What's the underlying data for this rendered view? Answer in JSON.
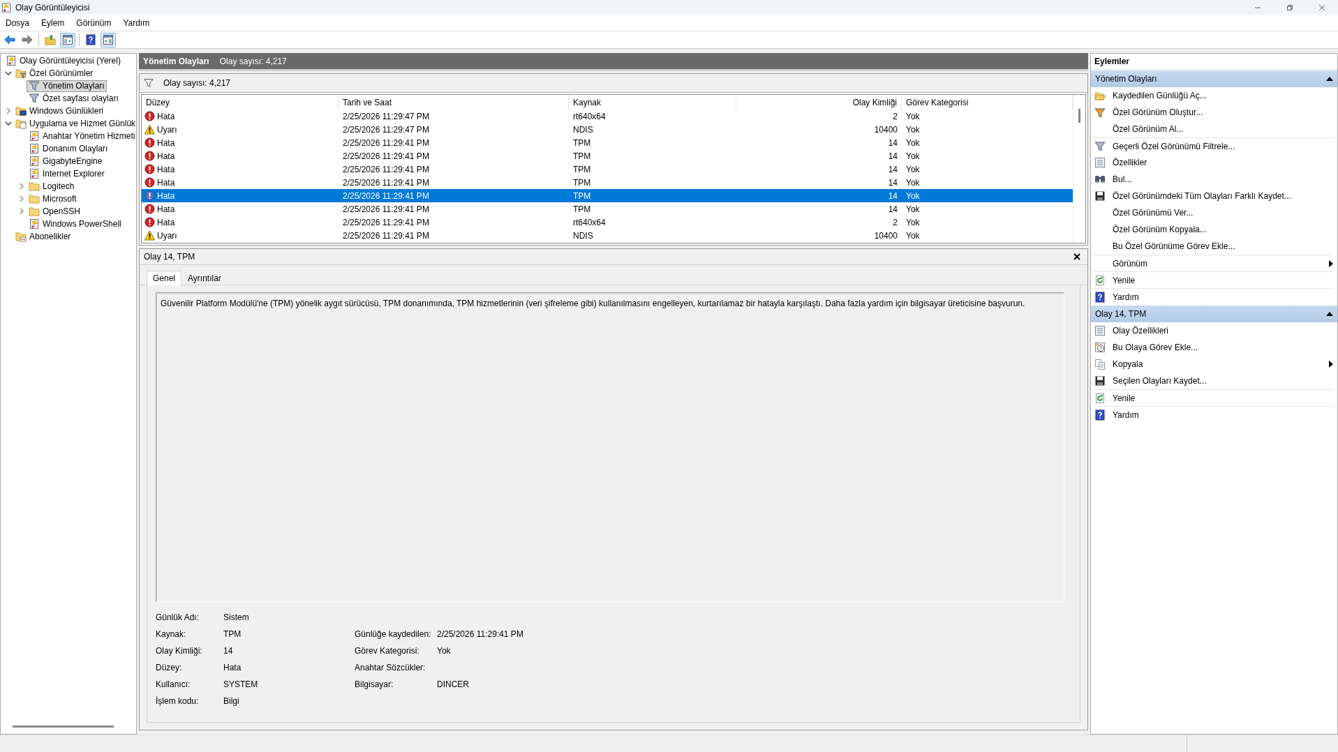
{
  "window": {
    "title": "Olay Görüntüleyicisi"
  },
  "menu": [
    "Dosya",
    "Eylem",
    "Görünüm",
    "Yardım"
  ],
  "toolbar": [
    {
      "kind": "back",
      "disabled": false,
      "pressed": false
    },
    {
      "kind": "forward",
      "disabled": true,
      "pressed": false
    },
    {
      "kind": "separator"
    },
    {
      "kind": "up",
      "disabled": false,
      "pressed": false
    },
    {
      "kind": "tree-pane",
      "disabled": false,
      "pressed": true
    },
    {
      "kind": "separator"
    },
    {
      "kind": "help",
      "disabled": false,
      "pressed": false
    },
    {
      "kind": "action-pane",
      "disabled": false,
      "pressed": true
    }
  ],
  "tree": [
    {
      "label": "Olay Görüntüleyicisi (Yerel)",
      "kind": "log",
      "selected": false,
      "children": [
        {
          "label": "Özel Görünümler",
          "kind": "folder-filter",
          "selected": false,
          "expanded": true,
          "children": [
            {
              "label": "Yönetim Olayları",
              "kind": "filter",
              "selected": true
            },
            {
              "label": "Özet sayfası olayları",
              "kind": "filter",
              "selected": false
            }
          ]
        },
        {
          "label": "Windows Günlükleri",
          "kind": "folder-monitor",
          "selected": false,
          "expanded": false
        },
        {
          "label": "Uygulama ve Hizmet Günlük",
          "kind": "folder-doc",
          "selected": false,
          "expanded": true,
          "children": [
            {
              "label": "Anahtar Yönetim Hizmeti",
              "kind": "log",
              "selected": false
            },
            {
              "label": "Donanım Olayları",
              "kind": "log",
              "selected": false
            },
            {
              "label": "GigabyteEngine",
              "kind": "log",
              "selected": false
            },
            {
              "label": "Internet Explorer",
              "kind": "log",
              "selected": false
            },
            {
              "label": "Logitech",
              "kind": "folder",
              "selected": false,
              "expanded": false
            },
            {
              "label": "Microsoft",
              "kind": "folder",
              "selected": false,
              "expanded": false
            },
            {
              "label": "OpenSSH",
              "kind": "folder",
              "selected": false,
              "expanded": false
            },
            {
              "label": "Windows PowerShell",
              "kind": "log",
              "selected": false
            }
          ]
        },
        {
          "label": "Abonelikler",
          "kind": "folder-sub",
          "selected": false
        }
      ]
    }
  ],
  "view_header": {
    "title": "Yönetim Olayları",
    "count": "Olay sayısı: 4,217"
  },
  "filter_bar": {
    "text": "Olay sayısı: 4,217"
  },
  "table": {
    "columns": [
      {
        "label": "Düzey",
        "kind": "text"
      },
      {
        "label": "Tarih ve Saat",
        "kind": "text"
      },
      {
        "label": "Kaynak",
        "kind": "text"
      },
      {
        "label": "Olay Kimliği",
        "kind": "number"
      },
      {
        "label": "Görev Kategorisi",
        "kind": "text"
      }
    ],
    "rows": [
      {
        "kind": "error",
        "selected": false,
        "cells": [
          "Hata",
          "2/25/2026 11:29:47 PM",
          "rt640x64",
          "2",
          "Yok"
        ]
      },
      {
        "kind": "warning",
        "selected": false,
        "cells": [
          "Uyarı",
          "2/25/2026 11:29:47 PM",
          "NDIS",
          "10400",
          "Yok"
        ]
      },
      {
        "kind": "error",
        "selected": false,
        "cells": [
          "Hata",
          "2/25/2026 11:29:41 PM",
          "TPM",
          "14",
          "Yok"
        ]
      },
      {
        "kind": "error",
        "selected": false,
        "cells": [
          "Hata",
          "2/25/2026 11:29:41 PM",
          "TPM",
          "14",
          "Yok"
        ]
      },
      {
        "kind": "error",
        "selected": false,
        "cells": [
          "Hata",
          "2/25/2026 11:29:41 PM",
          "TPM",
          "14",
          "Yok"
        ]
      },
      {
        "kind": "error",
        "selected": false,
        "cells": [
          "Hata",
          "2/25/2026 11:29:41 PM",
          "TPM",
          "14",
          "Yok"
        ]
      },
      {
        "kind": "error",
        "selected": true,
        "cells": [
          "Hata",
          "2/25/2026 11:29:41 PM",
          "TPM",
          "14",
          "Yok"
        ]
      },
      {
        "kind": "error",
        "selected": false,
        "cells": [
          "Hata",
          "2/25/2026 11:29:41 PM",
          "TPM",
          "14",
          "Yok"
        ]
      },
      {
        "kind": "error",
        "selected": false,
        "cells": [
          "Hata",
          "2/25/2026 11:29:41 PM",
          "rt640x64",
          "2",
          "Yok"
        ]
      },
      {
        "kind": "warning",
        "selected": false,
        "cells": [
          "Uyarı",
          "2/25/2026 11:29:41 PM",
          "NDIS",
          "10400",
          "Yok"
        ]
      }
    ]
  },
  "detail": {
    "title": "Olay 14, TPM",
    "tabs": [
      {
        "label": "Genel",
        "selected": true
      },
      {
        "label": "Ayrıntılar",
        "selected": false
      }
    ],
    "description": "Güvenilir Platform Modülü'ne (TPM) yönelik aygıt sürücüsü, TPM donanımında, TPM hizmetlerinin (veri şifreleme gibi) kullanılmasını engelleyen, kurtarılamaz bir hatayla karşılaştı. Daha fazla yardım için bilgisayar üreticisine başvurun.",
    "fields": [
      {
        "left": {
          "label": "Günlük Adı:",
          "value": "Sistem"
        }
      },
      {
        "left": {
          "label": "Kaynak:",
          "value": "TPM"
        },
        "right": {
          "label": "Günlüğe kaydedilen:",
          "value": "2/25/2026 11:29:41 PM"
        }
      },
      {
        "left": {
          "label": "Olay Kimliği:",
          "value": "14"
        },
        "right": {
          "label": "Görev Kategorisi:",
          "value": "Yok"
        }
      },
      {
        "left": {
          "label": "Düzey:",
          "value": "Hata"
        },
        "right": {
          "label": "Anahtar Sözcükler:"
        }
      },
      {
        "left": {
          "label": "Kullanıcı:",
          "value": "SYSTEM"
        },
        "right": {
          "label": "Bilgisayar:",
          "value": "DINCER"
        }
      },
      {
        "left": {
          "label": "İşlem kodu:",
          "value": "Bilgi"
        }
      }
    ]
  },
  "actions": {
    "title": "Eylemler",
    "sections": [
      {
        "title": "Yönetim Olayları",
        "expanded": true,
        "items": [
          {
            "label": "Kaydedilen Günlüğü Aç...",
            "kind": "open-folder",
            "divider": false,
            "submenu": false
          },
          {
            "label": "Özel Görünüm Oluştur...",
            "kind": "new-filter",
            "divider": false,
            "submenu": false
          },
          {
            "label": "Özel Görünüm Al...",
            "kind": "plain",
            "divider": false,
            "submenu": false
          },
          {
            "label": "Geçerli Özel Görünümü Filtrele...",
            "kind": "filter",
            "divider": true,
            "submenu": false
          },
          {
            "label": "Özellikler",
            "kind": "properties",
            "divider": false,
            "submenu": false
          },
          {
            "label": "Bul...",
            "kind": "binoculars",
            "divider": false,
            "submenu": false
          },
          {
            "label": "Özel Görünümdeki Tüm Olayları Farklı Kaydet...",
            "kind": "save",
            "divider": false,
            "submenu": false
          },
          {
            "label": "Özel Görünümü Ver...",
            "kind": "plain",
            "divider": false,
            "submenu": false
          },
          {
            "label": "Özel Görünüm Kopyala...",
            "kind": "plain",
            "divider": false,
            "submenu": false
          },
          {
            "label": "Bu Özel Görünüme Görev Ekle...",
            "kind": "plain",
            "divider": false,
            "submenu": false
          },
          {
            "label": "Görünüm",
            "kind": "plain",
            "divider": true,
            "submenu": true
          },
          {
            "label": "Yenile",
            "kind": "refresh",
            "divider": true,
            "submenu": false
          },
          {
            "label": "Yardım",
            "kind": "help",
            "divider": true,
            "submenu": false
          }
        ]
      },
      {
        "title": "Olay 14, TPM",
        "expanded": true,
        "items": [
          {
            "label": "Olay Özellikleri",
            "kind": "properties",
            "divider": false,
            "submenu": false
          },
          {
            "label": "Bu Olaya Görev Ekle...",
            "kind": "task",
            "divider": false,
            "submenu": false
          },
          {
            "label": "Kopyala",
            "kind": "copy",
            "divider": false,
            "submenu": true
          },
          {
            "label": "Seçilen Olayları Kaydet...",
            "kind": "save",
            "divider": false,
            "submenu": false
          },
          {
            "label": "Yenile",
            "kind": "refresh",
            "divider": true,
            "submenu": false
          },
          {
            "label": "Yardım",
            "kind": "help",
            "divider": true,
            "submenu": false
          }
        ]
      }
    ]
  }
}
